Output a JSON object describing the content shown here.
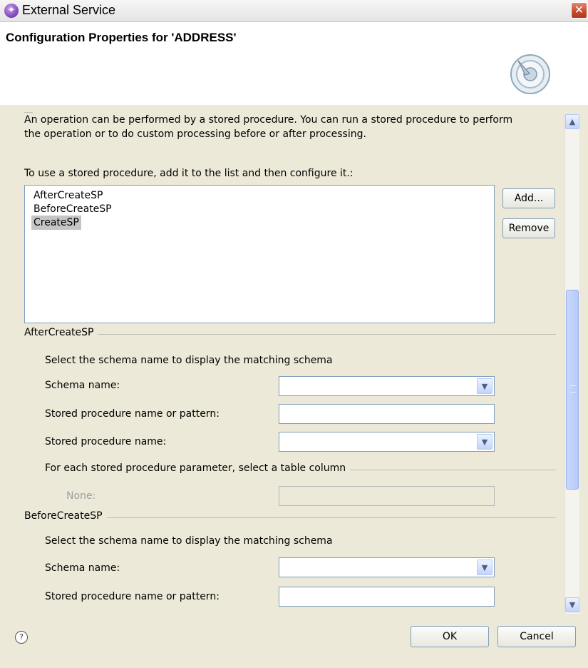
{
  "window": {
    "title": "External Service",
    "close_label": "✕"
  },
  "banner": {
    "title": "Configuration Properties for 'ADDRESS'"
  },
  "content": {
    "description_line1": "An operation can be performed by a stored procedure. You can run a stored procedure to perform",
    "description_line2": "the operation or to do custom processing before or after processing.",
    "instruction": "To use a stored procedure, add it to the list and then configure it.:",
    "procedures": [
      "AfterCreateSP",
      "BeforeCreateSP",
      "CreateSP"
    ],
    "selected_procedure": "CreateSP",
    "add_button": "Add...",
    "remove_button": "Remove"
  },
  "after_group": {
    "title": "AfterCreateSP",
    "hint": "Select the schema name to display the matching schema",
    "schema_label": "Schema name:",
    "schema_value": "",
    "pattern_label": "Stored procedure name or pattern:",
    "pattern_value": "",
    "proc_label": "Stored procedure name:",
    "proc_value": "",
    "param_title": "For each stored procedure parameter, select a table column",
    "none_label": "None:",
    "none_value": ""
  },
  "before_group": {
    "title": "BeforeCreateSP",
    "hint": "Select the schema name to display the matching schema",
    "schema_label": "Schema name:",
    "schema_value": "",
    "pattern_label": "Stored procedure name or pattern:",
    "pattern_value": ""
  },
  "footer": {
    "help_label": "?",
    "ok_label": "OK",
    "cancel_label": "Cancel"
  },
  "icons": {
    "dropdown": "chevron-down-icon",
    "scroll_up": "arrow-up-icon",
    "scroll_down": "arrow-down-icon"
  }
}
